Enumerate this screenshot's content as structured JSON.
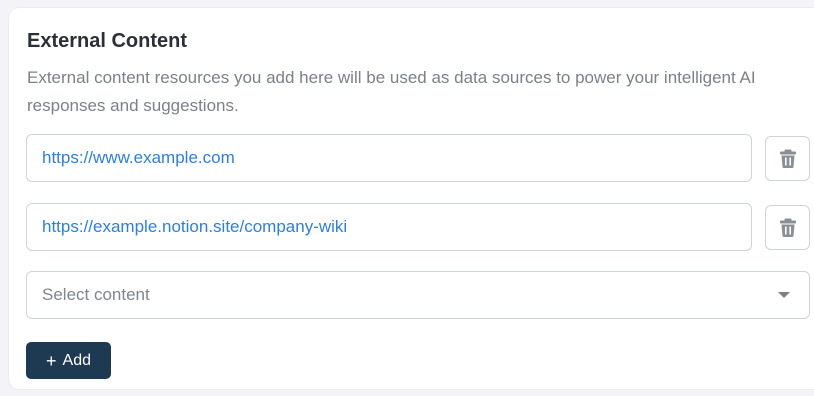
{
  "section": {
    "title": "External Content",
    "description": "External content resources you add here will be used as data sources to power your intelligent AI responses and suggestions."
  },
  "resources": [
    {
      "url": "https://www.example.com"
    },
    {
      "url": "https://example.notion.site/company-wiki"
    }
  ],
  "select": {
    "placeholder": "Select content"
  },
  "add_button": {
    "icon": "+",
    "label": "Add"
  },
  "icons": {
    "delete": "trash-icon",
    "dropdown": "caret-down-icon"
  },
  "colors": {
    "link_text": "#2f7fd6",
    "primary_button": "#1e3a52",
    "border": "#cfd3d9"
  }
}
